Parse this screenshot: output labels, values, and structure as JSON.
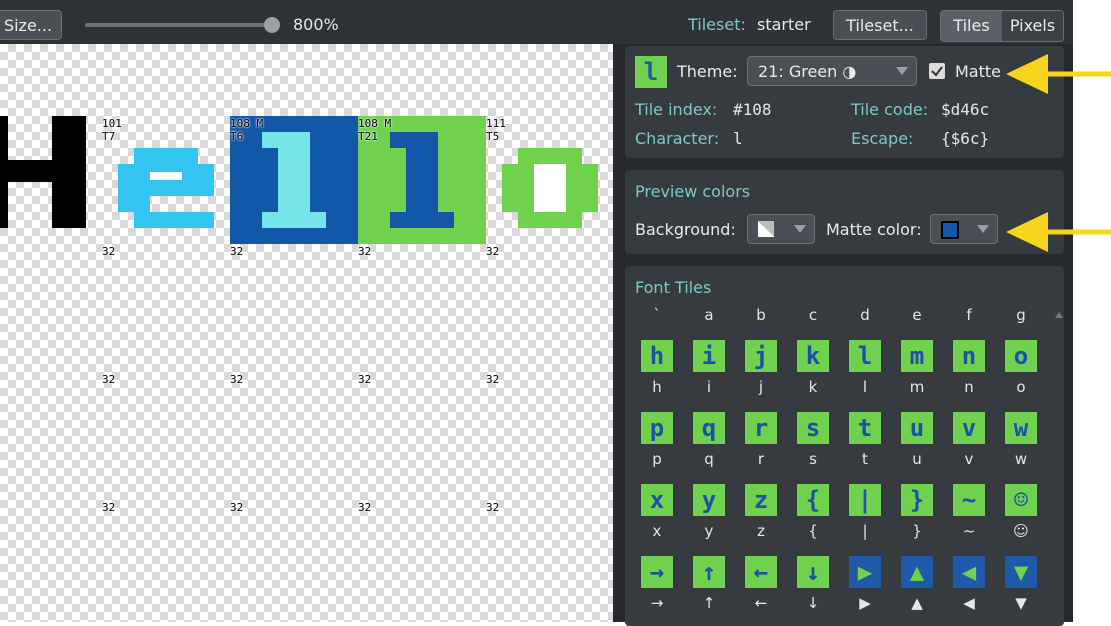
{
  "toolbar": {
    "size_button": "Size...",
    "zoom_value": "800%",
    "zoom_fraction": 0.95,
    "tileset_label": "Tileset:",
    "tileset_value": "starter",
    "tileset_button": "Tileset...",
    "mode_tiles": "Tiles",
    "mode_pixels": "Pixels"
  },
  "canvas": {
    "glyphs": [
      "H",
      "e",
      "l",
      "l",
      "o"
    ],
    "tags": {
      "e": "101\nT7",
      "l1": "108 M\nT6",
      "l2": "108 M\nT21",
      "o": "111\nT5",
      "empty": "32"
    }
  },
  "colors": {
    "accent": "#7ec8c8",
    "green": "#6fd14e",
    "blue": "#1f5aa8",
    "cyan": "#33c4f2",
    "highlight": "#f7d51d"
  },
  "tile_info": {
    "theme_label": "Theme:",
    "theme_value": "21: Green ◑",
    "matte_label": "Matte",
    "matte_checked": true,
    "tile_index_label": "Tile index:",
    "tile_index_value": "#108",
    "tile_code_label": "Tile code:",
    "tile_code_value": "$d46c",
    "character_label": "Character:",
    "character_value": "l",
    "escape_label": "Escape:",
    "escape_value": "{$6c}"
  },
  "preview_colors": {
    "title": "Preview colors",
    "background_label": "Background:",
    "matte_color_label": "Matte color:"
  },
  "font_tiles": {
    "title": "Font Tiles",
    "header_row": [
      "`",
      "a",
      "b",
      "c",
      "d",
      "e",
      "f",
      "g"
    ],
    "rows": [
      {
        "tiles": [
          "h",
          "i",
          "j",
          "k",
          "l",
          "m",
          "n",
          "o"
        ],
        "labels": [
          "h",
          "i",
          "j",
          "k",
          "l",
          "m",
          "n",
          "o"
        ]
      },
      {
        "tiles": [
          "p",
          "q",
          "r",
          "s",
          "t",
          "u",
          "v",
          "w"
        ],
        "labels": [
          "p",
          "q",
          "r",
          "s",
          "t",
          "u",
          "v",
          "w"
        ]
      },
      {
        "tiles": [
          "x",
          "y",
          "z",
          "{",
          "|",
          "}",
          "~",
          "☺"
        ],
        "labels": [
          "x",
          "y",
          "z",
          "{",
          "|",
          "}",
          "~",
          "☺"
        ]
      },
      {
        "tiles": [
          "→",
          "↑",
          "←",
          "↓",
          "▶",
          "▲",
          "◀",
          "▼"
        ],
        "labels": [
          "→",
          "↑",
          "←",
          "↓",
          "▶",
          "▲",
          "◀",
          "▼"
        ]
      }
    ]
  }
}
